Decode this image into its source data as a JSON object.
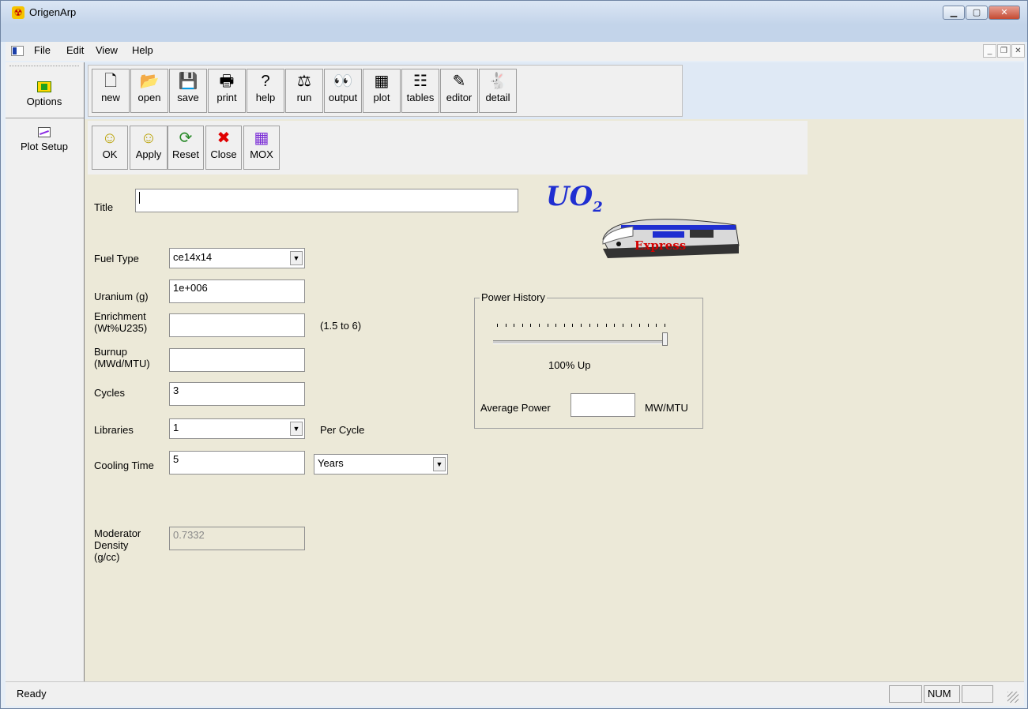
{
  "window": {
    "title": "OrigenArp"
  },
  "menu": [
    "File",
    "Edit",
    "View",
    "Help"
  ],
  "shortcut_bar": {
    "options_label": "Options",
    "plot_setup_label": "Plot Setup"
  },
  "toolbar": [
    {
      "label": "new",
      "icon": "new-file-icon"
    },
    {
      "label": "open",
      "icon": "open-folder-icon"
    },
    {
      "label": "save",
      "icon": "save-disk-icon"
    },
    {
      "label": "print",
      "icon": "printer-icon"
    },
    {
      "label": "help",
      "icon": "help-icon"
    },
    {
      "label": "run",
      "icon": "scales-icon"
    },
    {
      "label": "output",
      "icon": "eyes-icon"
    },
    {
      "label": "plot",
      "icon": "plot-icon"
    },
    {
      "label": "tables",
      "icon": "table-icon"
    },
    {
      "label": "editor",
      "icon": "pencil-icon"
    },
    {
      "label": "detail",
      "icon": "rabbit-icon"
    }
  ],
  "actions": [
    {
      "label": "OK",
      "icon": "smiley-icon"
    },
    {
      "label": "Apply",
      "icon": "smiley-icon"
    },
    {
      "label": "Reset",
      "icon": "refresh-icon"
    },
    {
      "label": "Close",
      "icon": "close-x-icon"
    },
    {
      "label": "MOX",
      "icon": "mox-grid-icon"
    }
  ],
  "form": {
    "title_label": "Title",
    "title_value": "",
    "fuel_type_label": "Fuel Type",
    "fuel_type_value": "ce14x14",
    "uranium_label": "Uranium (g)",
    "uranium_value": "1e+006",
    "enrichment_label_1": "Enrichment",
    "enrichment_label_2": "(Wt%U235)",
    "enrichment_value": "",
    "enrichment_hint": "(1.5 to 6)",
    "burnup_label_1": "Burnup",
    "burnup_label_2": "(MWd/MTU)",
    "burnup_value": "",
    "cycles_label": "Cycles",
    "cycles_value": "3",
    "libraries_label": "Libraries",
    "libraries_value": "1",
    "per_cycle": "Per Cycle",
    "cooling_label": "Cooling Time",
    "cooling_value": "5",
    "cooling_unit": "Years",
    "moderator_label_1": "Moderator",
    "moderator_label_2": "Density",
    "moderator_label_3": "(g/cc)",
    "moderator_value": "0.7332"
  },
  "power_history": {
    "title": "Power History",
    "slider_percent": 100,
    "slider_text": "100% Up",
    "average_power_label": "Average Power",
    "average_power_value": "",
    "unit": "MW/MTU"
  },
  "logo": {
    "formula": "UO",
    "subscript": "2",
    "train_text": "Express"
  },
  "status": {
    "text": "Ready",
    "num": "NUM"
  },
  "colors": {
    "logo_blue": "#1f2ed1",
    "train_red": "#d40000"
  }
}
